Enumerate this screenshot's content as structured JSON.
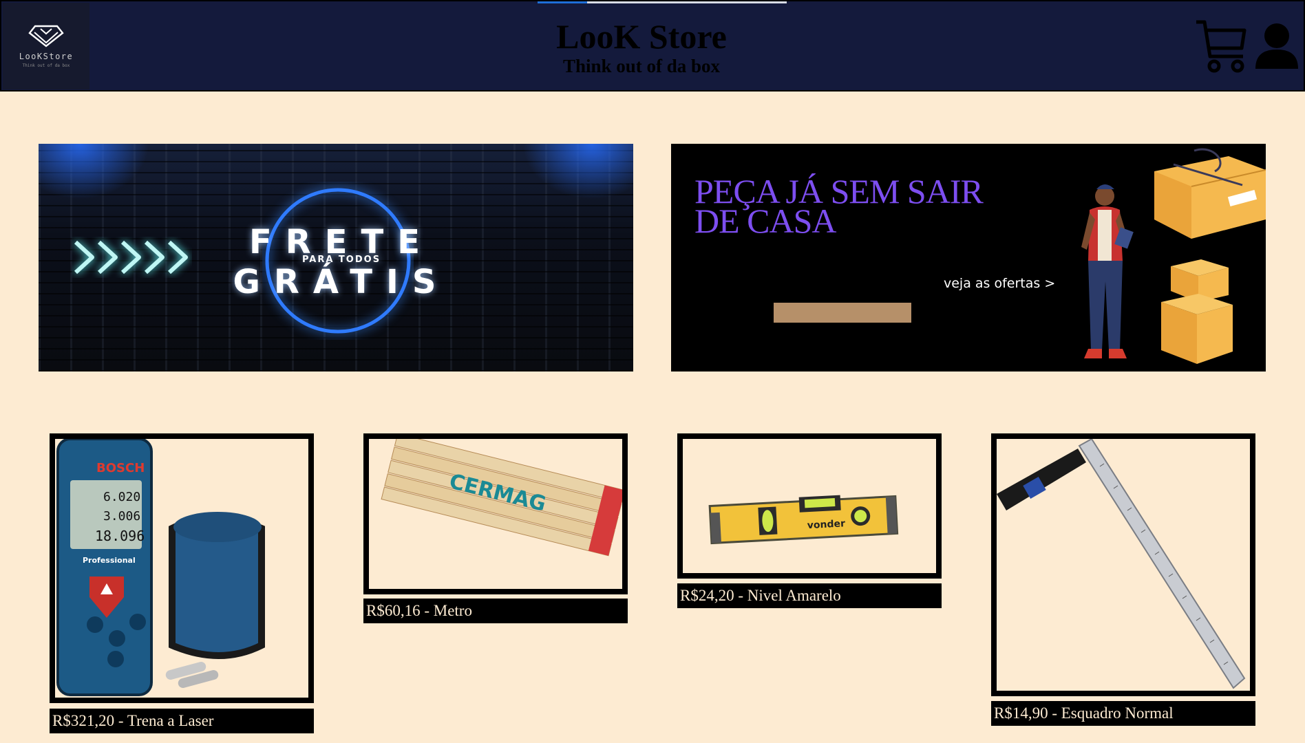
{
  "header": {
    "logo_name": "LooKStore",
    "logo_tagline": "Think out of da box",
    "title": "LooK Store",
    "subtitle": "Think out of da box"
  },
  "banners": {
    "frete": {
      "line1": "FRETE",
      "small": "PARA TODOS",
      "line2": "GRÁTIS"
    },
    "casa": {
      "title_line1": "PEÇA JÁ SEM SAIR",
      "title_line2": "DE CASA",
      "link": "veja as ofertas >"
    }
  },
  "products": [
    {
      "caption": "R$321,20 - Trena a Laser",
      "icon": "laser-measure-image"
    },
    {
      "caption": "R$60,16 - Metro",
      "icon": "folding-ruler-image"
    },
    {
      "caption": "R$24,20 - Nivel Amarelo",
      "icon": "spirit-level-image"
    },
    {
      "caption": "R$14,90 - Esquadro Normal",
      "icon": "try-square-image"
    }
  ],
  "colors": {
    "page_bg": "#fdebd2",
    "header_bg": "#141a3c",
    "promo_purple": "#7d4ef0"
  }
}
